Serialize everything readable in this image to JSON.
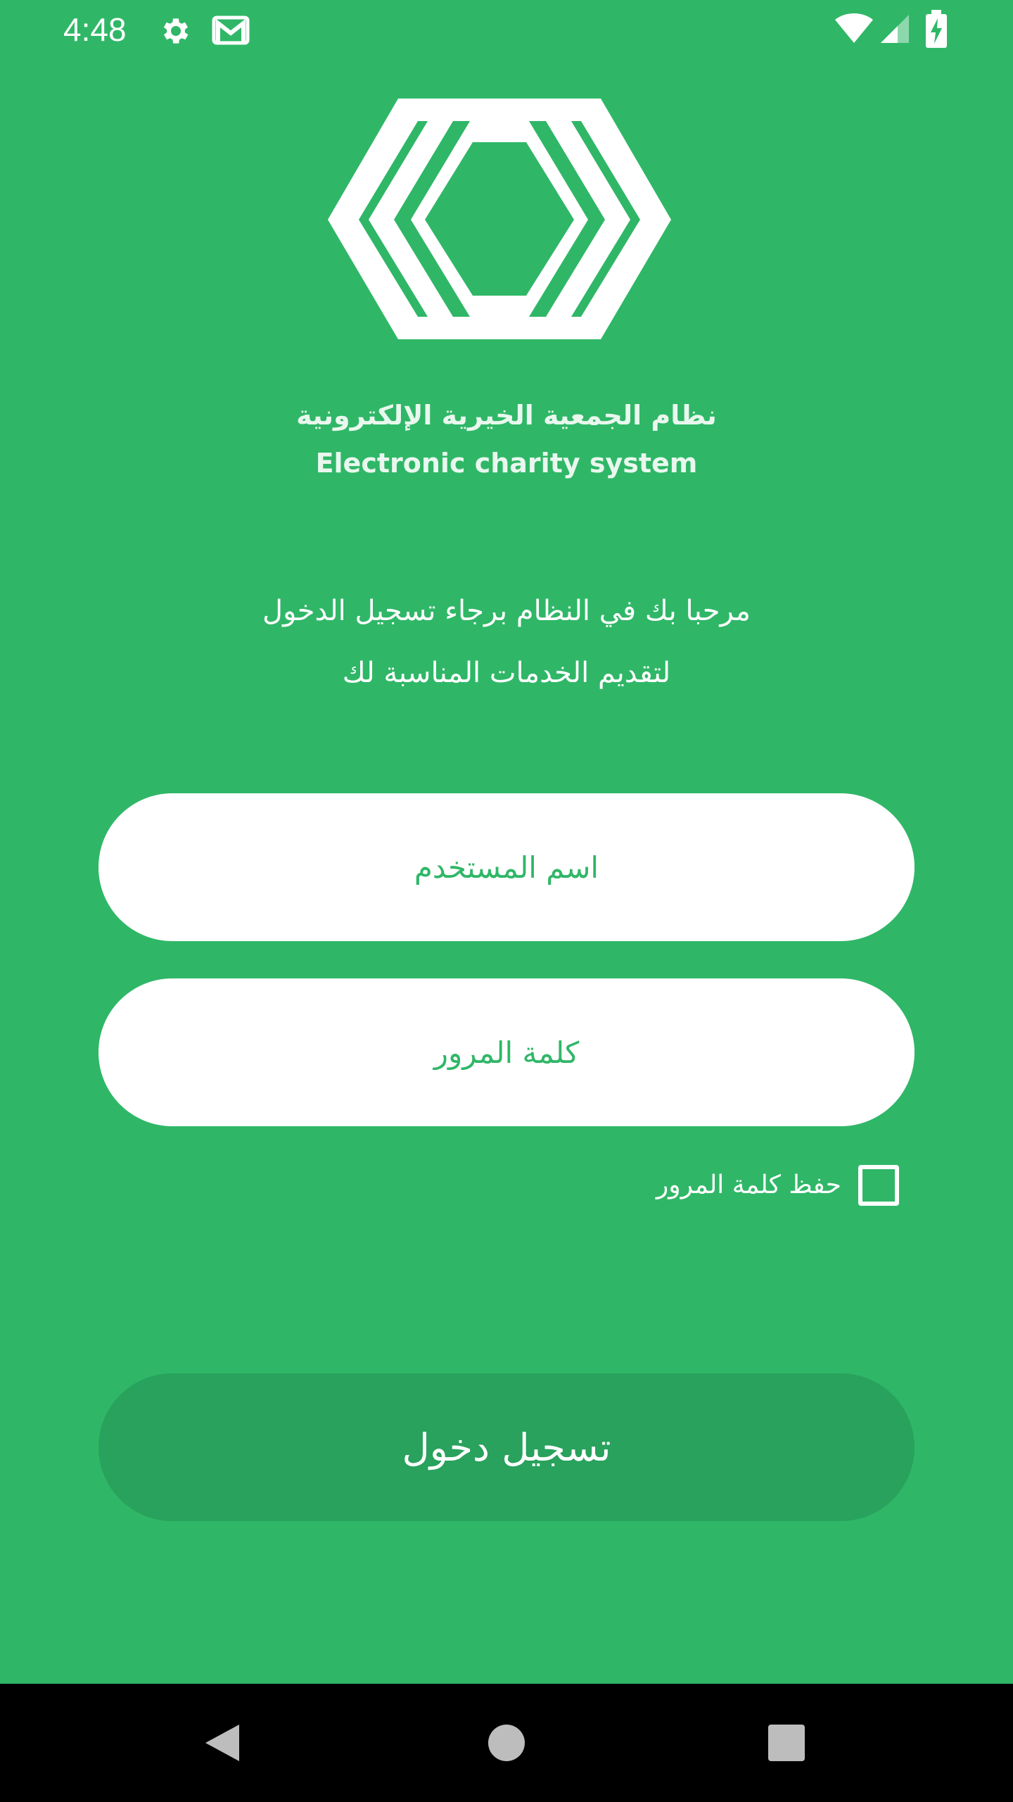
{
  "status_bar": {
    "time": "4:48",
    "icons": [
      "settings-icon",
      "gmail-icon",
      "wifi-icon",
      "signal-icon",
      "battery-charging-icon"
    ]
  },
  "brand": {
    "logo_icon": "hexagon-chevrons-logo",
    "title_ar": "نظام الجمعية الخيرية الإلكترونية",
    "title_en": "Electronic charity system"
  },
  "welcome": {
    "line1": "مرحبا بك في النظام برجاء تسجيل الدخول",
    "line2": "لتقديم الخدمات المناسبة لك"
  },
  "form": {
    "username_placeholder": "اسم المستخدم",
    "password_placeholder": "كلمة المرور",
    "remember_label": "حفظ كلمة المرور",
    "remember_checked": false,
    "login_label": "تسجيل دخول"
  },
  "nav_bar": {
    "buttons": [
      "back-icon",
      "home-icon",
      "recents-icon"
    ]
  },
  "colors": {
    "background": "#2fb767",
    "button": "#28a25c",
    "input_background": "#ffffff",
    "input_text": "#2fb767",
    "nav_bar": "#000000"
  }
}
